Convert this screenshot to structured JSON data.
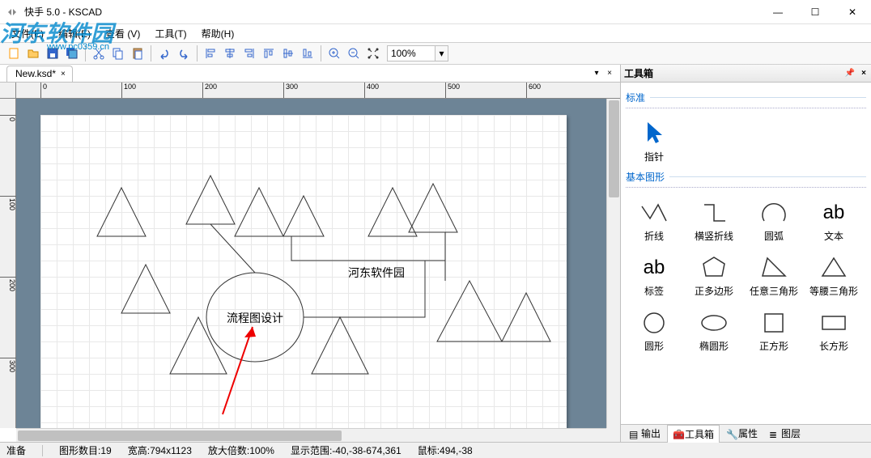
{
  "window": {
    "title": "快手 5.0 - KSCAD",
    "min": "—",
    "max": "☐",
    "close": "✕"
  },
  "watermark": {
    "main": "河东软件园",
    "sub": "www.pc0359.cn"
  },
  "menu": {
    "file": "文件(E)",
    "edit": "编辑(E)",
    "view": "查看 (V)",
    "tools": "工具(T)",
    "help": "帮助(H)"
  },
  "toolbar": {
    "zoom_value": "100%"
  },
  "tabs": {
    "doc": "New.ksd*"
  },
  "canvas": {
    "ellipse_text": "流程图设计",
    "label_text": "河东软件园"
  },
  "toolbox": {
    "title": "工具箱",
    "section_standard": "标准",
    "pointer": "指针",
    "section_shapes": "基本图形",
    "polyline": "折线",
    "hvpolyline": "横竖折线",
    "arc": "圆弧",
    "text": "文本",
    "text_glyph": "ab",
    "label": "标签",
    "polygon": "正多边形",
    "triangle_any": "任意三角形",
    "triangle_iso": "等腰三角形",
    "circle": "圆形",
    "ellipse": "椭圆形",
    "square": "正方形",
    "rect": "长方形"
  },
  "bottom_tabs": {
    "output": "输出",
    "toolbox": "工具箱",
    "props": "属性",
    "layers": "图层"
  },
  "status": {
    "ready": "准备",
    "count_label": "图形数目:",
    "count_val": "19",
    "size_label": "宽高:",
    "size_val": "794x1123",
    "zoom_label": "放大倍数:",
    "zoom_val": "100%",
    "range_label": "显示范围:",
    "range_val": "-40,-38-674,361",
    "mouse_label": "鼠标:",
    "mouse_val": "494,-38"
  }
}
